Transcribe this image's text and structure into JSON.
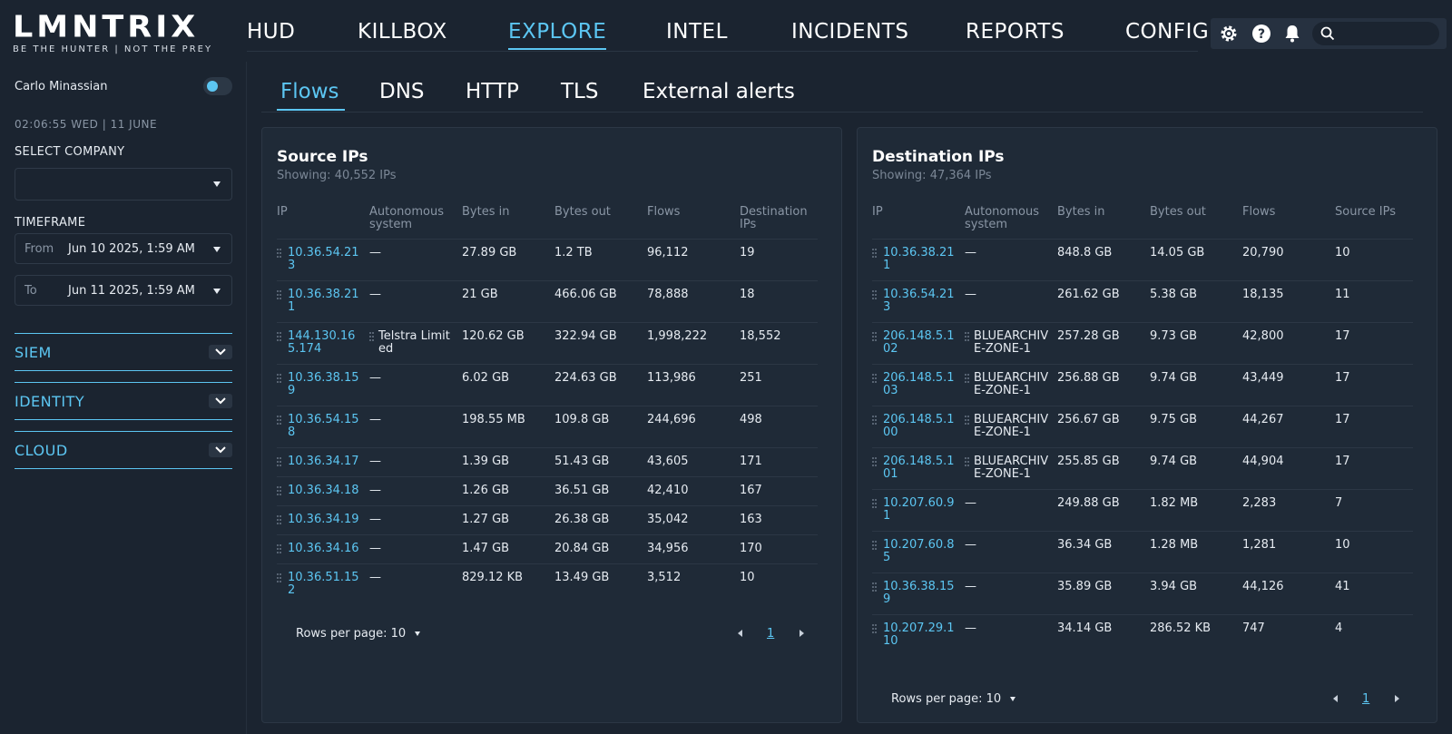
{
  "brand": {
    "wordmark": "LMNTRIX",
    "tagline": "BE THE HUNTER  |  NOT THE PREY"
  },
  "nav": {
    "items": [
      {
        "label": "HUD",
        "active": false
      },
      {
        "label": "KILLBOX",
        "active": false
      },
      {
        "label": "EXPLORE",
        "active": true
      },
      {
        "label": "INTEL",
        "active": false
      },
      {
        "label": "INCIDENTS",
        "active": false
      },
      {
        "label": "REPORTS",
        "active": false
      },
      {
        "label": "CONFIG",
        "active": false
      }
    ]
  },
  "toolbar": {
    "icons": [
      "gear-icon",
      "help-icon",
      "bell-icon"
    ],
    "search_placeholder": ""
  },
  "sidebar": {
    "user_name": "Carlo Minassian",
    "clock": "02:06:55  WED  |  11 JUNE",
    "select_company_label": "SELECT COMPANY",
    "select_company_value": "",
    "timeframe_label": "TIMEFRAME",
    "from_label": "From",
    "from_value": "Jun 10 2025, 1:59 AM",
    "to_label": "To",
    "to_value": "Jun 11 2025, 1:59 AM",
    "sections": [
      "SIEM",
      "IDENTITY",
      "CLOUD"
    ]
  },
  "subtabs": [
    {
      "label": "Flows",
      "active": true
    },
    {
      "label": "DNS",
      "active": false
    },
    {
      "label": "HTTP",
      "active": false
    },
    {
      "label": "TLS",
      "active": false
    },
    {
      "label": "External alerts",
      "active": false
    }
  ],
  "source": {
    "title": "Source IPs",
    "subtitle": "Showing: 40,552 IPs",
    "columns": [
      "IP",
      "Autonomous system",
      "Bytes in",
      "Bytes out",
      "Flows",
      "Destination IPs"
    ],
    "rows": [
      [
        "10.36.54.213",
        "—",
        "27.89 GB",
        "1.2 TB",
        "96,112",
        "19"
      ],
      [
        "10.36.38.211",
        "—",
        "21 GB",
        "466.06 GB",
        "78,888",
        "18"
      ],
      [
        "144.130.165.174",
        "Telstra Limited",
        "120.62 GB",
        "322.94 GB",
        "1,998,222",
        "18,552"
      ],
      [
        "10.36.38.159",
        "—",
        "6.02 GB",
        "224.63 GB",
        "113,986",
        "251"
      ],
      [
        "10.36.54.158",
        "—",
        "198.55 MB",
        "109.8 GB",
        "244,696",
        "498"
      ],
      [
        "10.36.34.17",
        "—",
        "1.39 GB",
        "51.43 GB",
        "43,605",
        "171"
      ],
      [
        "10.36.34.18",
        "—",
        "1.26 GB",
        "36.51 GB",
        "42,410",
        "167"
      ],
      [
        "10.36.34.19",
        "—",
        "1.27 GB",
        "26.38 GB",
        "35,042",
        "163"
      ],
      [
        "10.36.34.16",
        "—",
        "1.47 GB",
        "20.84 GB",
        "34,956",
        "170"
      ],
      [
        "10.36.51.152",
        "—",
        "829.12 KB",
        "13.49 GB",
        "3,512",
        "10"
      ]
    ],
    "rows_per_page": "Rows per page: 10",
    "page": "1"
  },
  "destination": {
    "title": "Destination IPs",
    "subtitle": "Showing: 47,364 IPs",
    "columns": [
      "IP",
      "Autonomous system",
      "Bytes in",
      "Bytes out",
      "Flows",
      "Source IPs"
    ],
    "rows": [
      [
        "10.36.38.211",
        "—",
        "848.8 GB",
        "14.05 GB",
        "20,790",
        "10"
      ],
      [
        "10.36.54.213",
        "—",
        "261.62 GB",
        "5.38 GB",
        "18,135",
        "11"
      ],
      [
        "206.148.5.102",
        "BLUEARCHIVE-ZONE-1",
        "257.28 GB",
        "9.73 GB",
        "42,800",
        "17"
      ],
      [
        "206.148.5.103",
        "BLUEARCHIVE-ZONE-1",
        "256.88 GB",
        "9.74 GB",
        "43,449",
        "17"
      ],
      [
        "206.148.5.100",
        "BLUEARCHIVE-ZONE-1",
        "256.67 GB",
        "9.75 GB",
        "44,267",
        "17"
      ],
      [
        "206.148.5.101",
        "BLUEARCHIVE-ZONE-1",
        "255.85 GB",
        "9.74 GB",
        "44,904",
        "17"
      ],
      [
        "10.207.60.91",
        "—",
        "249.88 GB",
        "1.82 MB",
        "2,283",
        "7"
      ],
      [
        "10.207.60.85",
        "—",
        "36.34 GB",
        "1.28 MB",
        "1,281",
        "10"
      ],
      [
        "10.36.38.159",
        "—",
        "35.89 GB",
        "3.94 GB",
        "44,126",
        "41"
      ],
      [
        "10.207.29.110",
        "—",
        "34.14 GB",
        "286.52 KB",
        "747",
        "4"
      ]
    ],
    "rows_per_page": "Rows per page: 10",
    "page": "1"
  },
  "colors": {
    "accent": "#5cc6f2",
    "background": "#1b2430",
    "panel": "#1f2a37"
  }
}
